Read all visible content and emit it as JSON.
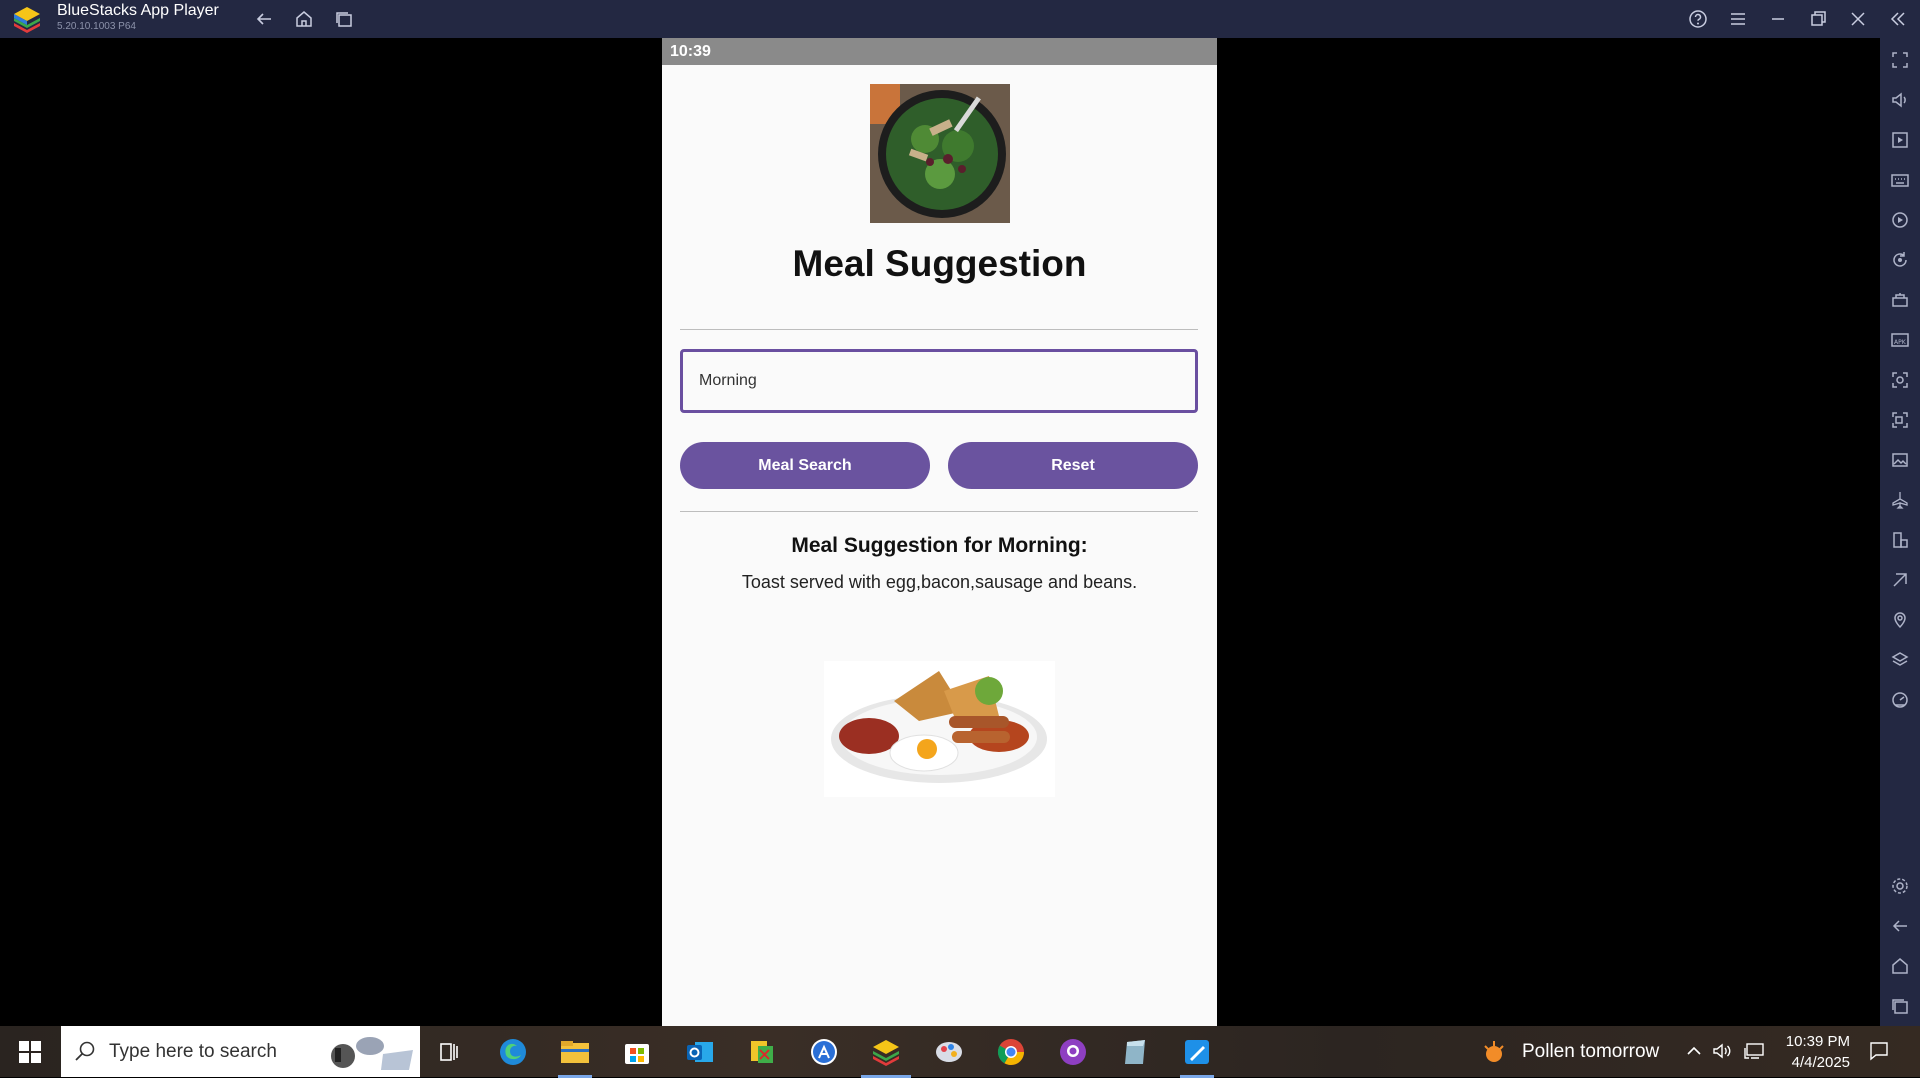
{
  "window": {
    "app_name": "BlueStacks App Player",
    "version": "5.20.10.1003  P64"
  },
  "phone": {
    "status_time": "10:39",
    "page_title": "Meal Suggestion",
    "input": {
      "value": "Morning",
      "placeholder": ""
    },
    "buttons": {
      "search": "Meal Search",
      "reset": "Reset"
    },
    "result_title": "Meal Suggestion for Morning:",
    "result_text": "Toast served with egg,bacon,sausage and beans."
  },
  "taskbar": {
    "search_placeholder": "Type here to search",
    "weather": "Pollen tomorrow",
    "time": "10:39 PM",
    "date": "4/4/2025"
  },
  "colors": {
    "accent": "#6a539f",
    "titlebar": "#232842"
  },
  "sidebar_icons": [
    "fullscreen-icon",
    "volume-icon",
    "media-manager-icon",
    "keyboard-controls-icon",
    "macro-icon",
    "rotate-icon",
    "multi-instance-icon",
    "install-apk-icon",
    "screenshot-icon",
    "screen-record-icon",
    "gallery-icon",
    "airplane-mode-icon",
    "resize-icon",
    "eco-mode-icon",
    "location-icon",
    "layers-icon",
    "performance-icon",
    "settings-icon",
    "back-icon",
    "home-icon",
    "recent-apps-icon"
  ]
}
